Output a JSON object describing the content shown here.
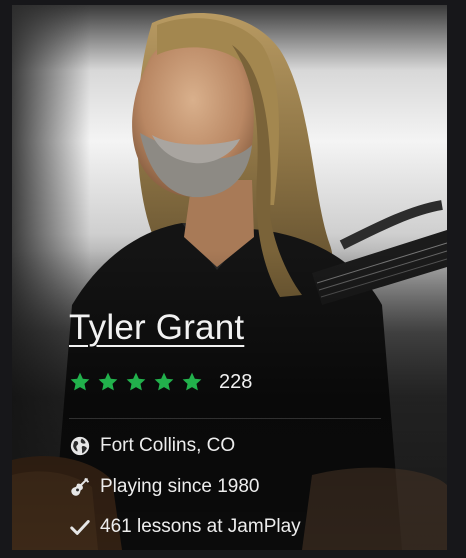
{
  "instructor": {
    "name": "Tyler Grant",
    "rating": {
      "stars": 5,
      "review_count": "228",
      "star_color": "#22b14c"
    },
    "details": {
      "location": "Fort Collins, CO",
      "playing_since": "Playing since 1980",
      "lessons": "461 lessons at JamPlay"
    },
    "icons": [
      "globe-icon",
      "guitar-icon",
      "checkmark-icon"
    ]
  }
}
